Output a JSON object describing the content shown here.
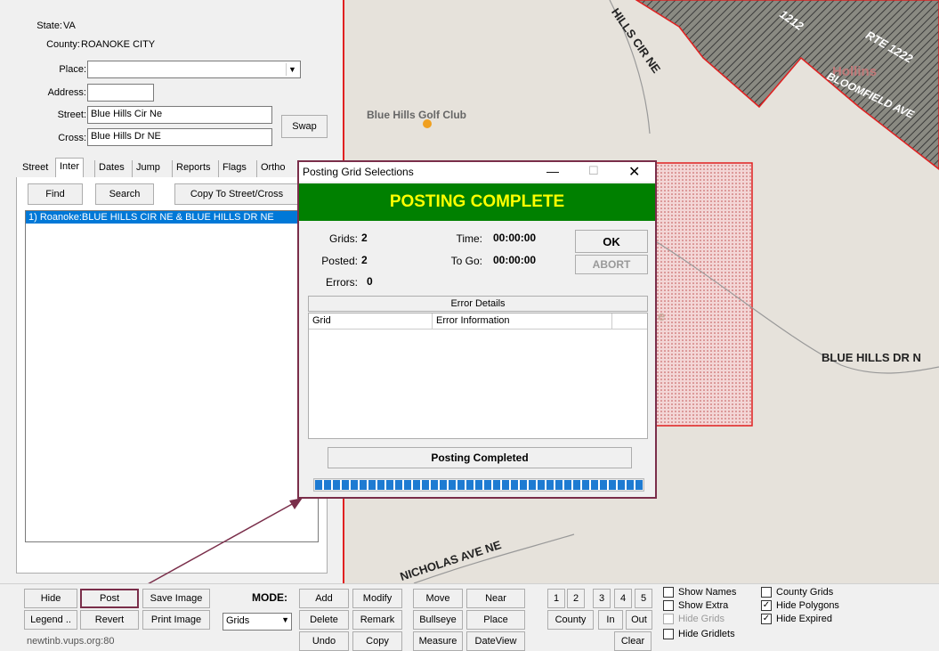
{
  "location": {
    "state_label": "State:",
    "state_value": "VA",
    "county_label": "County:",
    "county_value": "ROANOKE CITY",
    "place_label": "Place:",
    "place_value": "",
    "address_label": "Address:",
    "address_value": "",
    "street_label": "Street:",
    "street_value": "Blue Hills Cir Ne",
    "cross_label": "Cross:",
    "cross_value": "Blue Hills Dr NE",
    "swap_label": "Swap"
  },
  "tabs": [
    "Street",
    "Inter",
    "Dates",
    "Jump",
    "Reports",
    "Flags",
    "Ortho"
  ],
  "inter": {
    "find_label": "Find",
    "search_label": "Search",
    "copy_label": "Copy To Street/Cross",
    "results": [
      "1) Roanoke:BLUE HILLS CIR NE & BLUE HILLS DR NE"
    ]
  },
  "map": {
    "labels": {
      "golf": "Blue Hills Golf Club",
      "cir": "HILLS CIR NE",
      "rte1212": "1212",
      "rte1222": "RTE 1222",
      "bloomfield": "BLOOMFIELD AVE",
      "hollins": "Hollins",
      "bluehillsdr": "BLUE HILLS DR N",
      "nicholas": "NICHOLAS AVE NE",
      "partial": "e"
    },
    "colors": {
      "background": "#e6e2db",
      "boundary": "#e02020",
      "hatch": "#3a3a3a",
      "dot": "#f0a020"
    }
  },
  "dialog": {
    "title": "Posting Grid Selections",
    "banner": "POSTING COMPLETE",
    "banner_bg": "#008000",
    "banner_fg": "#ffff00",
    "grids_label": "Grids:",
    "grids_value": "2",
    "posted_label": "Posted:",
    "posted_value": "2",
    "errors_label": "Errors:",
    "errors_value": "0",
    "time_label": "Time:",
    "time_value": "00:00:00",
    "togo_label": "To Go:",
    "togo_value": "00:00:00",
    "ok_label": "OK",
    "abort_label": "ABORT",
    "error_details_label": "Error Details",
    "col_grid": "Grid",
    "col_error": "Error Information",
    "status": "Posting Completed",
    "progress": 1.0,
    "progress_color": "#1e7bd2"
  },
  "bottom": {
    "hide": "Hide",
    "post": "Post",
    "save_image": "Save Image",
    "legend": "Legend ..",
    "revert": "Revert",
    "print_image": "Print Image",
    "server": "newtinb.vups.org:80",
    "mode_label": "MODE:",
    "mode_value": "Grids",
    "add": "Add",
    "modify": "Modify",
    "delete": "Delete",
    "remark": "Remark",
    "undo": "Undo",
    "copy": "Copy",
    "move": "Move",
    "near": "Near",
    "bullseye": "Bullseye",
    "place": "Place",
    "measure": "Measure",
    "dateview": "DateView",
    "n1": "1",
    "n2": "2",
    "n3": "3",
    "n4": "4",
    "n5": "5",
    "county": "County",
    "in": "In",
    "out": "Out",
    "clear": "Clear"
  },
  "checks": {
    "show_names": "Show Names",
    "show_extra": "Show Extra",
    "hide_grids": "Hide Grids",
    "hide_gridlets": "Hide Gridlets",
    "county_grids": "County Grids",
    "hide_polygons": "Hide Polygons",
    "hide_expired": "Hide Expired",
    "check_mark": "✓"
  }
}
